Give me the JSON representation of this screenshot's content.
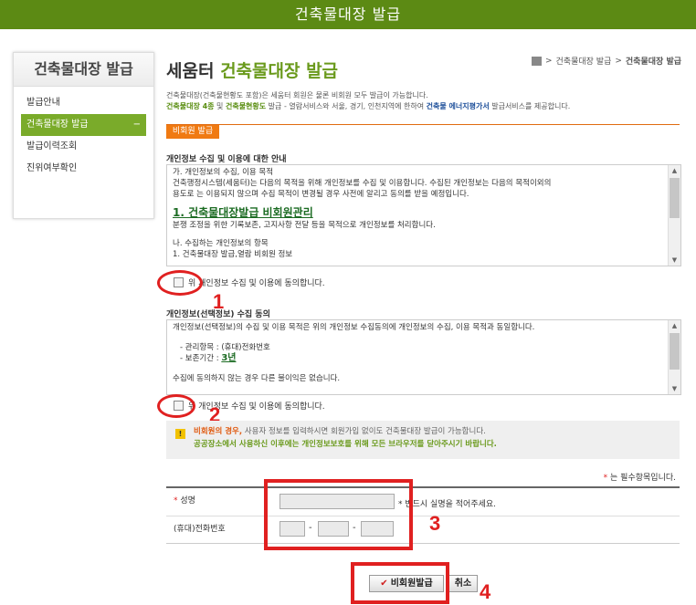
{
  "header": {
    "title": "건축물대장 발급"
  },
  "sidebar": {
    "title": "건축물대장 발급",
    "items": [
      {
        "label": "발급안내"
      },
      {
        "label": "건축물대장 발급",
        "suffix": "−"
      },
      {
        "label": "발급이력조회"
      },
      {
        "label": "진위여부확인"
      }
    ]
  },
  "page": {
    "title_prefix": "세움터 ",
    "title_main": "건축물대장 발급",
    "breadcrumb": {
      "home_icon": "home-icon",
      "sep": ">",
      "crumb1": "건축물대장 발급",
      "crumb2": "건축물대장 발급"
    },
    "intro_line1": "건축물대장(건축물현황도 포함)은 세움터 회원은 물론 비회원 모두 발급이 가능합니다.",
    "intro_line2_a": "건축물대장 4종",
    "intro_line2_b": " 및 ",
    "intro_line2_c": "건축물현황도",
    "intro_line2_d": " 발급 - 열람서비스와 서울, 경기, 인천지역에 한하여 ",
    "intro_line2_e": "건축물 에너지평가서",
    "intro_line2_f": " 발급서비스를 제공합니다.",
    "tab_label": "비회원 발급"
  },
  "consent1": {
    "title": "개인정보 수집 및 이용에 대한 안내",
    "lines": [
      "가. 개인정보의 수집, 이용 목적",
      "건축행정시스템(세움터)는 다음의 목적을 위해 개인정보를 수집 및 이용합니다. 수집된 개인정보는 다음의 목적이외의",
      "용도로 는 이용되지 않으며 수집 목적이 변경될 경우 사전에 알리고 동의를 받을 예정입니다."
    ],
    "link": "1. 건축물대장발급 비회원관리",
    "line4": "분쟁 조정을 위한 기록보존, 고지사항 전달 등을 목적으로 개인정보를 처리합니다.",
    "line5": "나. 수집하는 개인정보의 항목",
    "line6": "1. 건축물대장 발급,열람 비회원 정보",
    "checkbox_label": "위 개인정보 수집 및 이용에 동의합니다."
  },
  "consent2": {
    "title": "개인정보(선택정보) 수집 동의",
    "line1": "개인정보(선택정보)의 수집 및 이용 목적은 위의 개인정보 수집동의에 개인정보의 수집, 이용 목적과 동일합니다.",
    "item1": "- 관리항목 : (휴대)전화번호",
    "item2_prefix": "- 보존기간 : ",
    "item2_value": "3년",
    "line_last": "수집에 동의하지 않는 경우 다른 불이익은 없습니다.",
    "checkbox_label": "위 개인정보 수집 및 이용에 동의합니다."
  },
  "notice": {
    "icon": "warning-icon",
    "line1_highlight": "비회원의 경우,",
    "line1_rest": " 사용자 정보를 입력하시면 회원가입 없이도 건축물대장 발급이 가능합니다.",
    "line2": "공공장소에서 사용하신 이후에는 개인정보보호를 위해 모든 브라우저를 닫아주시기 바랍니다."
  },
  "form": {
    "required_note_star": "*",
    "required_note": " 는 필수항목입니다.",
    "name_star": "*",
    "name_label": " 성명",
    "name_hint": "* 반드시 실명을 적어주세요.",
    "phone_label": "(휴대)전화번호",
    "dash": "-"
  },
  "buttons": {
    "submit": "비회원발급",
    "submit_icon": "check-icon",
    "cancel": "취소"
  },
  "annotations": {
    "n1": "1",
    "n2": "2",
    "n3": "3",
    "n4": "4"
  },
  "colors": {
    "header_green": "#5c8a14",
    "accent_green": "#6a9a1c",
    "orange": "#f07a12",
    "annotation_red": "#e02020"
  }
}
